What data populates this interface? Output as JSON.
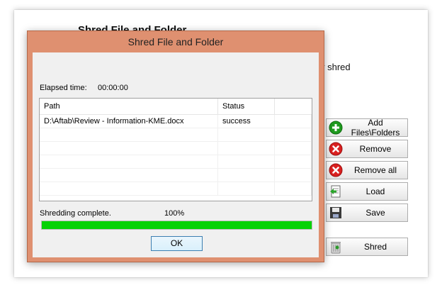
{
  "main": {
    "title": "Shred File and Folder",
    "desc": "y shred",
    "buttons": {
      "add": "Add Files\\Folders",
      "remove": "Remove",
      "remove_all": "Remove all",
      "load": "Load",
      "save": "Save",
      "shred": "Shred"
    }
  },
  "dialog": {
    "title": "Shred File and Folder",
    "elapsed_label": "Elapsed time:",
    "elapsed_value": "00:00:00",
    "columns": [
      "Path",
      "Status"
    ],
    "rows": [
      {
        "path": "D:\\Aftab\\Review - Information-KME.docx",
        "status": "success"
      }
    ],
    "progress_label": "Shredding complete.",
    "progress_percent": "100%",
    "progress_value": 100,
    "ok": "OK"
  },
  "colors": {
    "dialog_frame": "#df9070",
    "progress_fill": "#06d206"
  },
  "icons": {
    "add": "green-plus-circle-icon",
    "remove": "red-x-circle-icon",
    "remove_all": "red-x-circle-icon",
    "load": "document-arrow-icon",
    "save": "floppy-disk-icon",
    "shred": "trash-can-icon"
  }
}
